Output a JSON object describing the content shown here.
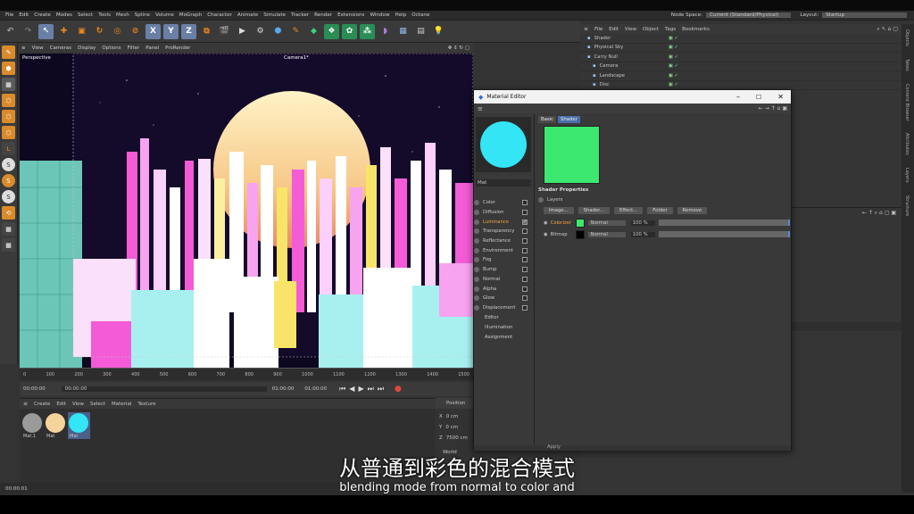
{
  "menu": [
    "File",
    "Edit",
    "Create",
    "Modes",
    "Select",
    "Tools",
    "Mesh",
    "Spline",
    "Volume",
    "MoGraph",
    "Character",
    "Animate",
    "Simulate",
    "Tracker",
    "Render",
    "Extensions",
    "Window",
    "Help",
    "Octane"
  ],
  "node_space_label": "Node Space:",
  "node_space_value": "Current (Standard/Physical)",
  "layout_label": "Layout:",
  "layout_value": "Startup",
  "viewport_menu": [
    "View",
    "Cameras",
    "Display",
    "Options",
    "Filter",
    "Panel",
    "ProRender"
  ],
  "viewport_label": "Perspective",
  "camera_label": "Camera1*",
  "timeline_ticks": [
    "0",
    "100",
    "200",
    "300",
    "400",
    "500",
    "600",
    "700",
    "800",
    "900",
    "1000",
    "1100",
    "1200",
    "1300",
    "1400",
    "1500"
  ],
  "transport": {
    "t1": "00:00:00",
    "t2": "00:00:00",
    "t3": "01:00:00",
    "t4": "01:00:00"
  },
  "mat_menu": [
    "Create",
    "Edit",
    "View",
    "Select",
    "Material",
    "Texture"
  ],
  "materials": [
    {
      "name": "Mat.1",
      "color": "#9a9a9a"
    },
    {
      "name": "Mat",
      "color": "#f6d39a"
    },
    {
      "name": "Mat",
      "color": "#33e5f5"
    }
  ],
  "coord": {
    "title": "Position",
    "x": "0 cm",
    "y": "0 cm",
    "z": "7500 cm",
    "world": "World"
  },
  "obj_menu": [
    "File",
    "Edit",
    "View",
    "Object",
    "Tags",
    "Bookmarks"
  ],
  "objects": [
    "Shader",
    "Physical Sky",
    "Carry Null",
    "Camera",
    "Landscape",
    "Disc"
  ],
  "right_tabs": [
    "Objects",
    "Takes",
    "Content Browser",
    "Attributes",
    "Layers",
    "Structure"
  ],
  "status_time": "00:00:01",
  "mated": {
    "title": "Material Editor",
    "mat_name": "Mat",
    "channels": [
      {
        "name": "Color",
        "checked": false,
        "active": false
      },
      {
        "name": "Diffusion",
        "checked": false,
        "active": false
      },
      {
        "name": "Luminance",
        "checked": true,
        "active": true
      },
      {
        "name": "Transparency",
        "checked": false,
        "active": false
      },
      {
        "name": "Reflectance",
        "checked": false,
        "active": false
      },
      {
        "name": "Environment",
        "checked": false,
        "active": false
      },
      {
        "name": "Fog",
        "checked": false,
        "active": false
      },
      {
        "name": "Bump",
        "checked": false,
        "active": false
      },
      {
        "name": "Normal",
        "checked": false,
        "active": false
      },
      {
        "name": "Alpha",
        "checked": false,
        "active": false
      },
      {
        "name": "Glow",
        "checked": false,
        "active": false
      },
      {
        "name": "Displacement",
        "checked": false,
        "active": false
      }
    ],
    "extra": [
      "Editor",
      "Illumination",
      "Assignment"
    ],
    "tabs": [
      "Basic",
      "Shader"
    ],
    "shader_props": "Shader Properties",
    "layers_label": "Layers",
    "buttons": [
      "Image...",
      "Shader...",
      "Effect...",
      "Folder",
      "Remove"
    ],
    "layers": [
      {
        "name": "Colorizer",
        "swatch": "#3ce870",
        "mode": "Normal",
        "pct": "100 %"
      },
      {
        "name": "Bitmap",
        "swatch": "#000000",
        "mode": "Normal",
        "pct": "100 %"
      }
    ],
    "apply": "Apply"
  },
  "subtitle_cn": "从普通到彩色的混合模式",
  "subtitle_en": "blending mode from normal to color and"
}
